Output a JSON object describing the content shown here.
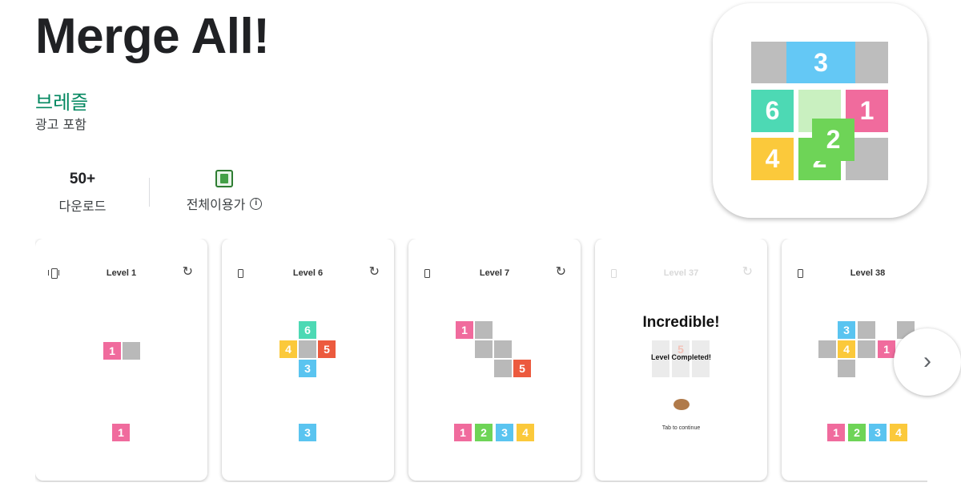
{
  "app": {
    "title": "Merge All!",
    "developer": "브레즐",
    "ads_label": "광고 포함"
  },
  "stats": {
    "downloads_value": "50+",
    "downloads_label": "다운로드",
    "rating_label": "전체이용가",
    "info_icon": "i"
  },
  "icon": {
    "bar_number": "3",
    "tiles": [
      "6",
      "1",
      "4",
      "2",
      "2"
    ]
  },
  "screenshots": [
    {
      "level": "Level 1",
      "restart_icon": "↻",
      "tiles": [
        "1",
        "1"
      ]
    },
    {
      "level": "Level 6",
      "restart_icon": "↻",
      "tiles": [
        "6",
        "4",
        "5",
        "3",
        "3"
      ]
    },
    {
      "level": "Level 7",
      "restart_icon": "↻",
      "tiles": [
        "1",
        "5",
        "1",
        "2",
        "3",
        "4"
      ]
    },
    {
      "level": "Level 37",
      "restart_icon": "↻",
      "headline": "Incredible!",
      "subline": "Level Completed!",
      "tile": "5",
      "tap": "Tab to continue"
    },
    {
      "level": "Level 38",
      "restart_icon": "↻",
      "tiles": [
        "3",
        "4",
        "1",
        "1",
        "2",
        "3",
        "4"
      ]
    }
  ],
  "next_button": "›",
  "colors": {
    "developer": "#01875f",
    "pink": "#f06b9d",
    "teal": "#4dd9b4",
    "yellow": "#fbc93b",
    "blue": "#5ac4f0",
    "green": "#6ed457",
    "orange": "#ec5a3e"
  }
}
